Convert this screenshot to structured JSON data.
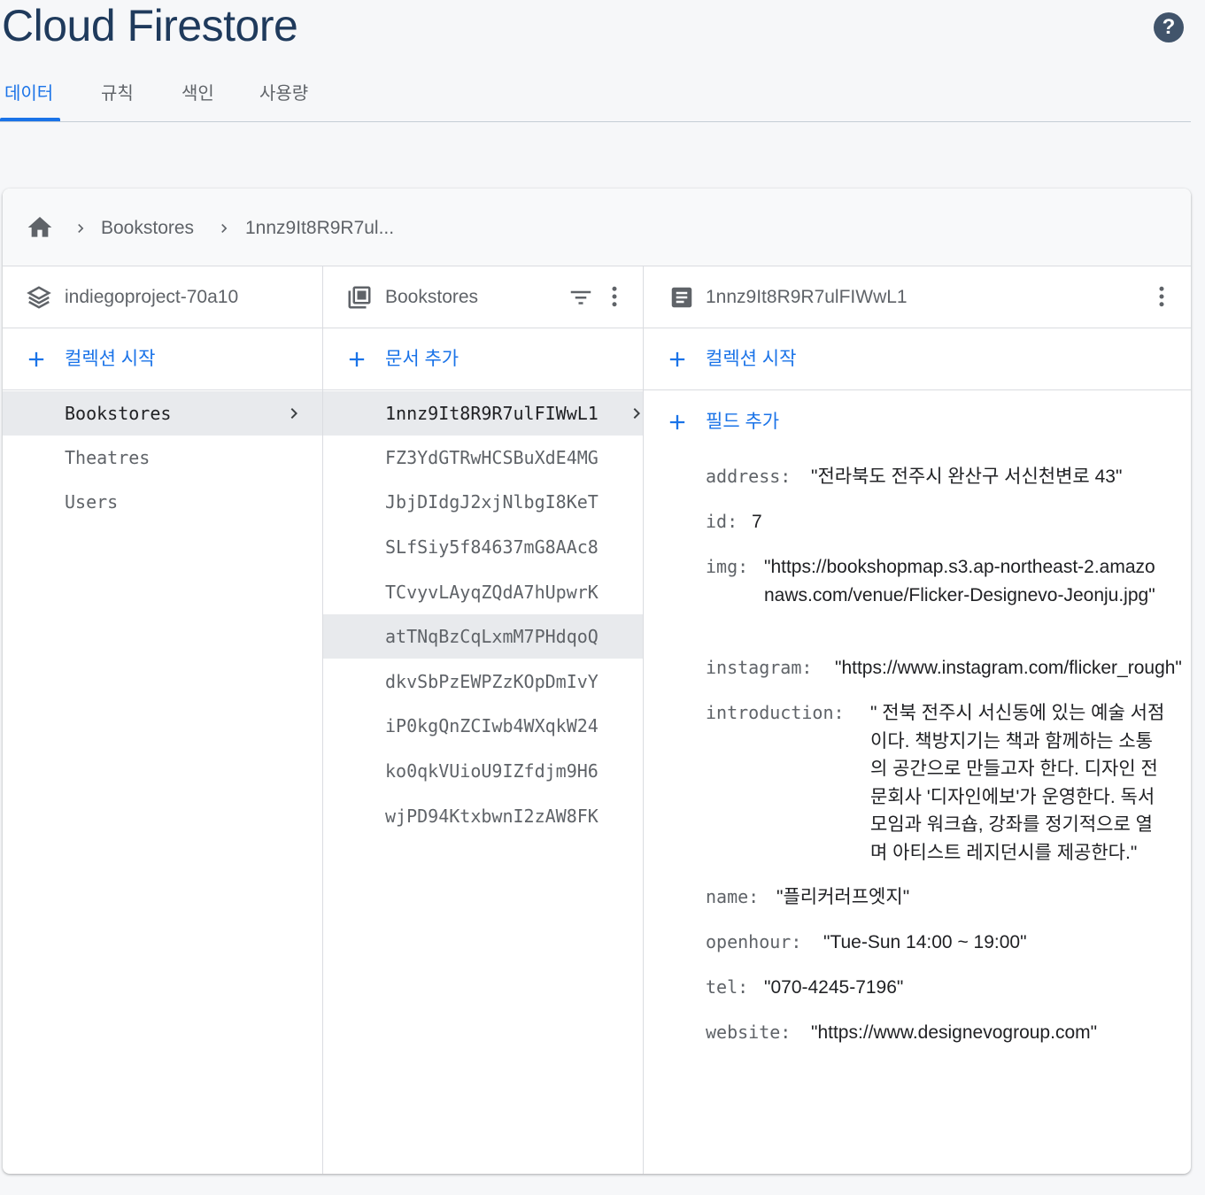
{
  "header": {
    "title": "Cloud Firestore",
    "help_icon": "help-circle-icon"
  },
  "tabs": [
    {
      "label": "데이터",
      "active": true
    },
    {
      "label": "규칙",
      "active": false
    },
    {
      "label": "색인",
      "active": false
    },
    {
      "label": "사용량",
      "active": false
    }
  ],
  "breadcrumb": {
    "home_icon": "home-icon",
    "items": [
      "Bookstores",
      "1nnz9It8R9R7ul..."
    ]
  },
  "root_column": {
    "title": "indiegoproject-70a10",
    "icon": "firestore-stack-icon",
    "add_label": "컬렉션 시작",
    "items": [
      "Bookstores",
      "Theatres",
      "Users"
    ],
    "selected": "Bookstores"
  },
  "collection_column": {
    "title": "Bookstores",
    "icon": "collection-icon",
    "add_label": "문서 추가",
    "items": [
      "1nnz9It8R9R7ulFIWwL1",
      "FZ3YdGTRwHCSBuXdE4MG",
      "JbjDIdgJ2xjNlbgI8KeT",
      "SLfSiy5f84637mG8AAc8",
      "TCvyvLAyqZQdA7hUpwrK",
      "atTNqBzCqLxmM7PHdqoQ",
      "dkvSbPzEWPZzKOpDmIvY",
      "iP0kgQnZCIwb4WXqkW24",
      "ko0qkVUioU9IZfdjm9H6",
      "wjPD94KtxbwnI2zAW8FK"
    ],
    "selected": "1nnz9It8R9R7ulFIWwL1",
    "hovered": "atTNqBzCqLxmM7PHdqoQ"
  },
  "document_column": {
    "title": "1nnz9It8R9R7ulFIWwL1",
    "icon": "document-icon",
    "add_collection_label": "컬렉션 시작",
    "add_field_label": "필드 추가",
    "fields": [
      {
        "key": "address:",
        "value": "\"전라북도 전주시 완산구 서신천변로 43\""
      },
      {
        "key": "id:",
        "value": "7"
      },
      {
        "key": "img:",
        "value": "\"https://bookshopmap.s3.ap-northeast-2.amazonaws.com/venue/Flicker-Designevo-Jeonju.jpg\""
      },
      {
        "key": "instagram:",
        "value": "\"https://www.instagram.com/flicker_rough\""
      },
      {
        "key": "introduction:",
        "value": "\" 전북 전주시 서신동에 있는 예술 서점이다. 책방지기는 책과 함께하는 소통의 공간으로 만들고자 한다. 디자인 전문회사 '디자인에보'가 운영한다. 독서모임과 워크숍, 강좌를 정기적으로 열며 아티스트 레지던시를 제공한다.\""
      },
      {
        "key": "name:",
        "value": "\"플리커러프엣지\""
      },
      {
        "key": "openhour:",
        "value": "\"Tue-Sun 14:00 ~ 19:00\""
      },
      {
        "key": "tel:",
        "value": "\"070-4245-7196\""
      },
      {
        "key": "website:",
        "value": "\"https://www.designevogroup.com\""
      }
    ]
  },
  "colors": {
    "accent": "#1a73e8",
    "title": "#1f3a5c",
    "muted": "#5f6368",
    "selected_bg": "#e8eaed"
  }
}
